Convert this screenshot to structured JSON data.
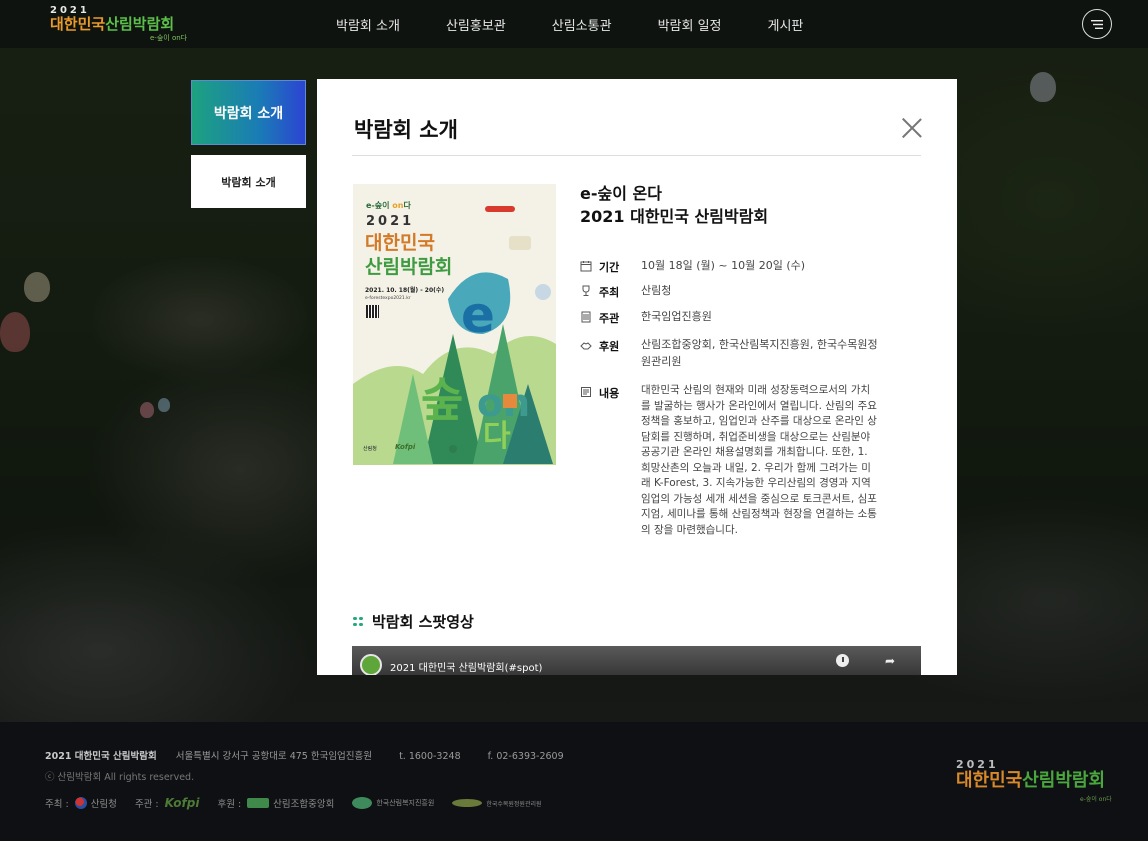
{
  "header": {
    "logo": {
      "year": "2021",
      "main_part1": "대한민국",
      "main_part2": "산림박람회",
      "sub": "e-숲이 on다"
    },
    "nav": [
      "박람회 소개",
      "산림홍보관",
      "산림소통관",
      "박람회 일정",
      "게시판"
    ],
    "menu_icon": "hamburger-icon"
  },
  "side": {
    "title": "박람회 소개",
    "items": [
      "박람회 소개"
    ]
  },
  "modal": {
    "title": "박람회 소개",
    "poster": {
      "tag_prefix": "e-숲이 ",
      "tag_on": "on",
      "tag_suffix": "다",
      "year": "2021",
      "line1": "대한민국",
      "line2": "산림박람회",
      "date": "2021. 10. 18(월) - 20(수)",
      "url": "e-forestexpo2021.kr",
      "logo1": "산림청",
      "logo2": "Kofpi"
    },
    "info_title_1": "e-숲이 온다",
    "info_title_2": "2021 대한민국 산림박람회",
    "rows": [
      {
        "icon": "calendar-icon",
        "label": "기간",
        "value": "10월 18일 (월) ~ 10월 20일 (수)"
      },
      {
        "icon": "trophy-icon",
        "label": "주최",
        "value": "산림청"
      },
      {
        "icon": "building-icon",
        "label": "주관",
        "value": "한국임업진흥원"
      },
      {
        "icon": "handshake-icon",
        "label": "후원",
        "value": "산림조합중앙회, 한국산림복지진흥원, 한국수목원정원관리원"
      },
      {
        "icon": "document-icon",
        "label": "내용",
        "value": "대한민국 산림의 현재와 미래 성장동력으로서의 가치를 발굴하는 행사가 온라인에서 열립니다. 산림의 주요 정책을 홍보하고, 임업인과 산주를 대상으로 온라인 상담회를 진행하며, 취업준비생을 대상으로는 산림분야 공공기관 온라인 채용설명회를 개최합니다. 또한, 1. 희망산촌의 오늘과 내일, 2. 우리가 함께 그려가는 미래 K-Forest, 3. 지속가능한 우리산림의 경영과 지역임업의 가능성 세개 세션을 중심으로 토크콘서트, 심포지엄, 세미나를 통해 산림정책과 현장을 연결하는 소통의 장을 마련했습니다."
      }
    ],
    "spot_title": "박람회 스팟영상",
    "video_title": "2021 대한민국 산림박람회(#spot)"
  },
  "footer": {
    "org_name": "2021 대한민국 산림박람회",
    "address": "서울특별시 강서구 공항대로 475 한국임업진흥원",
    "tel": "t. 1600-3248",
    "fax": "f. 02-6393-2609",
    "copyright": "ⓒ 산림박람회 All rights reserved.",
    "host_label": "주최 :",
    "host": "산림청",
    "organizer_label": "주관 :",
    "organizer": "Kofpi",
    "sponsor_label": "후원 :",
    "sponsors": [
      "산림조합중앙회",
      "한국산림복지진흥원",
      "한국수목원정원관리원"
    ],
    "logo": {
      "year": "2021",
      "main_part1": "대한민국",
      "main_part2": "산림박람회",
      "sub": "e-숲이 on다"
    }
  }
}
